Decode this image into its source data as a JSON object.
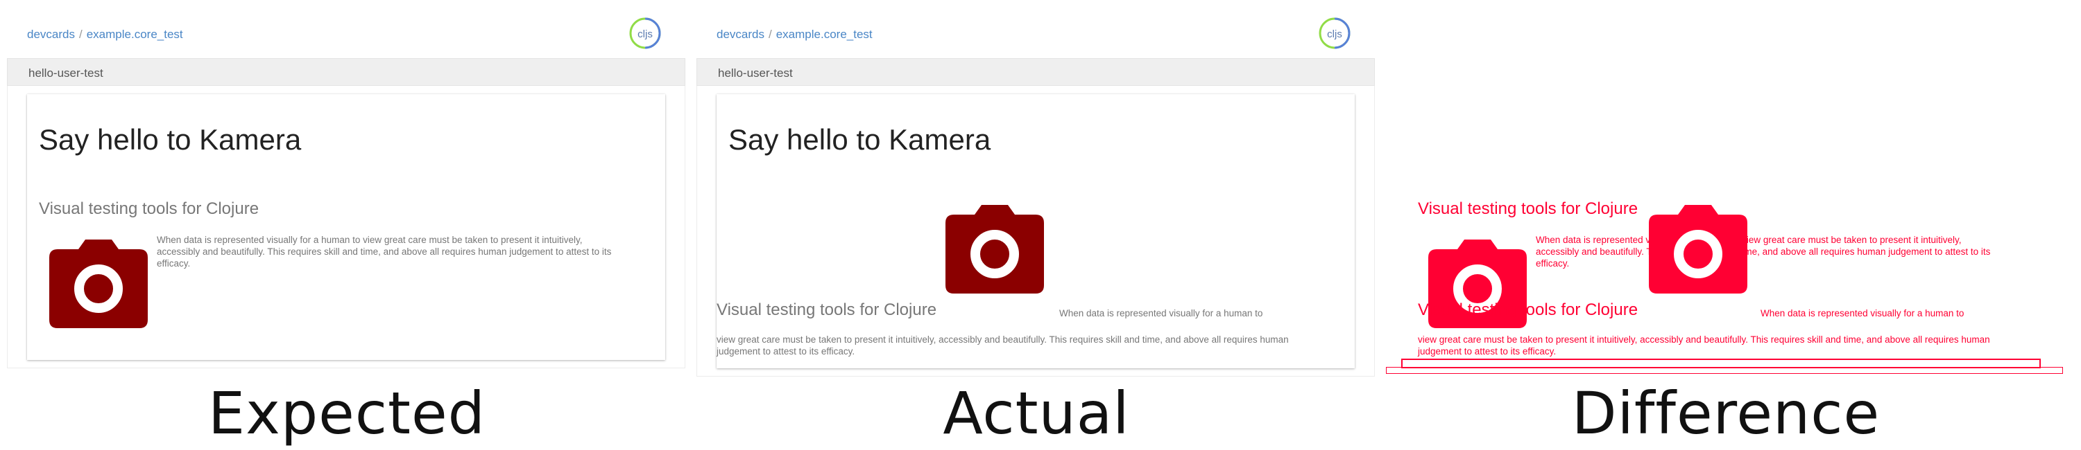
{
  "panels": {
    "expected": {
      "breadcrumb": {
        "root": "devcards",
        "separator": "/",
        "namespace": "example.core_test"
      },
      "logo_text": "cljs",
      "card_title": "hello-user-test",
      "heading": "Say hello to Kamera",
      "subheading": "Visual testing tools for Clojure",
      "body": "When data is represented visually for a human to view great care must be taken to present it intuitively, accessibly and beautifully. This requires skill and time, and above all requires human judgement to attest to its efficacy.",
      "caption": "Expected"
    },
    "actual": {
      "breadcrumb": {
        "root": "devcards",
        "separator": "/",
        "namespace": "example.core_test"
      },
      "logo_text": "cljs",
      "card_title": "hello-user-test",
      "heading": "Say hello to Kamera",
      "subheading": "Visual testing tools for Clojure",
      "body_inline": "When data is represented visually for a human to",
      "body_rest": "view great care must be taken to present it intuitively, accessibly and beautifully. This requires skill and time, and above all requires human judgement to attest to its efficacy.",
      "caption": "Actual"
    },
    "diff": {
      "subheading_a": "Visual testing tools for Clojure",
      "body_a": "When data is represented visually for a human to view great care must be taken to present it intuitively, accessibly and beautifully. This requires skill and time, and above all requires human judgement to attest to its efficacy.",
      "subheading_b": "Visual testing tools for Clojure",
      "body_b_inline": "When data is represented visually for a human to",
      "body_b_rest": "view great care must be taken to present it intuitively, accessibly and beautifully. This requires skill and time, and above all requires human judgement to attest to its efficacy.",
      "caption": "Difference"
    }
  },
  "colors": {
    "camera": "#8b0000",
    "diff": "#ff0033",
    "link": "#4a86c6",
    "header_bg": "#efefef"
  },
  "icons": {
    "camera": "camera-icon",
    "logo": "cljs-logo-icon"
  }
}
